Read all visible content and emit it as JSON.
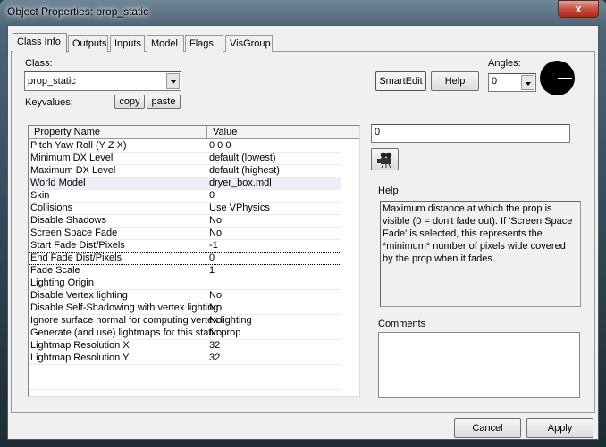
{
  "window": {
    "title": "Object Properties: prop_static",
    "close_glyph": "x"
  },
  "tabs": [
    {
      "label": "Class Info",
      "active": true
    },
    {
      "label": "Outputs"
    },
    {
      "label": "Inputs"
    },
    {
      "label": "Model"
    },
    {
      "label": "Flags"
    },
    {
      "label": "VisGroup"
    }
  ],
  "class_info": {
    "class_label": "Class:",
    "class_value": "prop_static",
    "keyvalues_label": "Keyvalues:",
    "copy_label": "copy",
    "paste_label": "paste",
    "smartedit_label": "SmartEdit",
    "help_label": "Help",
    "angles_label": "Angles:",
    "angles_value": "0",
    "table": {
      "headers": [
        "Property Name",
        "Value"
      ],
      "rows": [
        {
          "name": "Pitch Yaw Roll (Y Z X)",
          "value": "0 0 0"
        },
        {
          "name": "Minimum DX Level",
          "value": "default (lowest)"
        },
        {
          "name": "Maximum DX Level",
          "value": "default (highest)"
        },
        {
          "name": "World Model",
          "value": "dryer_box.mdl"
        },
        {
          "name": "Skin",
          "value": "0"
        },
        {
          "name": "Collisions",
          "value": "Use VPhysics"
        },
        {
          "name": "Disable Shadows",
          "value": "No"
        },
        {
          "name": "Screen Space Fade",
          "value": "No"
        },
        {
          "name": "Start Fade Dist/Pixels",
          "value": "-1"
        },
        {
          "name": "End Fade Dist/Pixels",
          "value": "0"
        },
        {
          "name": "Fade Scale",
          "value": "1"
        },
        {
          "name": "Lighting Origin",
          "value": ""
        },
        {
          "name": "Disable Vertex lighting",
          "value": "No"
        },
        {
          "name": "Disable Self-Shadowing with vertex lighting",
          "value": "No"
        },
        {
          "name": "Ignore surface normal for computing vertex lighting",
          "value": "No"
        },
        {
          "name": "Generate (and use) lightmaps for this static prop",
          "value": "No"
        },
        {
          "name": "Lightmap Resolution X",
          "value": "32"
        },
        {
          "name": "Lightmap Resolution Y",
          "value": "32"
        }
      ],
      "selected_row": "World Model",
      "focused_row": "End Fade Dist/Pixels"
    },
    "value_field": "0",
    "camera_icon": "movie-camera-icon",
    "help_heading": "Help",
    "help_text": "Maximum distance at which the prop is visible (0 = don't fade out). If 'Screen Space Fade' is selected, this represents the *minimum* number of pixels wide covered by the prop when it fades.",
    "comments_label": "Comments",
    "comments_value": ""
  },
  "footer": {
    "cancel_label": "Cancel",
    "apply_label": "Apply"
  }
}
